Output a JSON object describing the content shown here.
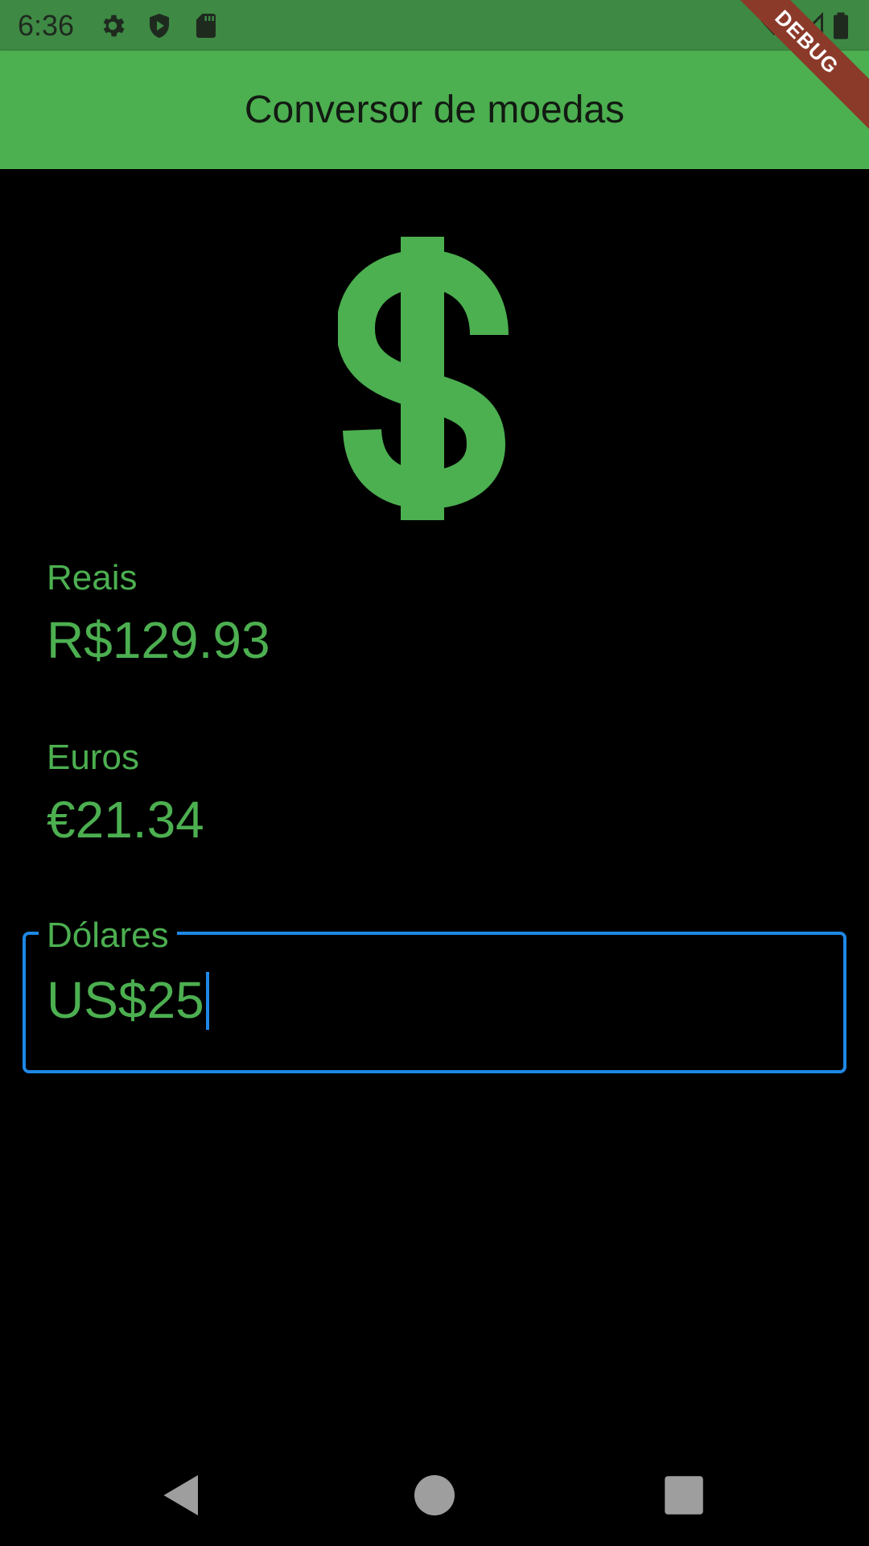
{
  "status_bar": {
    "time": "6:36",
    "icons": [
      "gear-icon",
      "shield-play-icon",
      "sd-card-icon",
      "wifi-icon",
      "signal-icon",
      "battery-icon"
    ]
  },
  "app_bar": {
    "title": "Conversor de moedas",
    "color": "#4caf50"
  },
  "debug_banner": {
    "label": "DEBUG"
  },
  "main": {
    "icon": "dollar-sign-icon",
    "reais": {
      "label": "Reais",
      "value": "R$129.93"
    },
    "euros": {
      "label": "Euros",
      "value": "€21.34"
    },
    "dolares": {
      "label": "Dólares",
      "value": "US$25"
    }
  },
  "nav_bar": {
    "buttons": [
      "back-icon",
      "home-icon",
      "recents-icon"
    ]
  },
  "colors": {
    "accent": "#4caf50",
    "focus": "#1e88e5",
    "background": "#000000"
  }
}
